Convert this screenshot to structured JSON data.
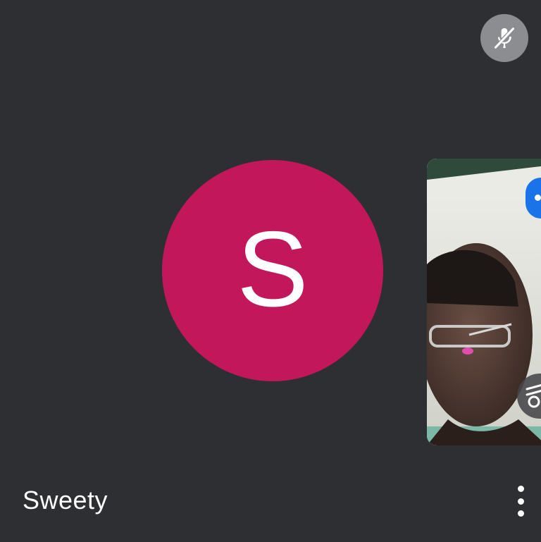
{
  "participant": {
    "name": "Sweety",
    "initial": "S",
    "avatar_color": "#c2185b",
    "mic_status_icon": "mic-off-icon"
  },
  "self_view": {
    "menu_icon": "more-icon",
    "effects_icon": "effects-icon"
  },
  "tile": {
    "background_color": "#2e2f33",
    "more_icon": "more-vert-icon"
  }
}
